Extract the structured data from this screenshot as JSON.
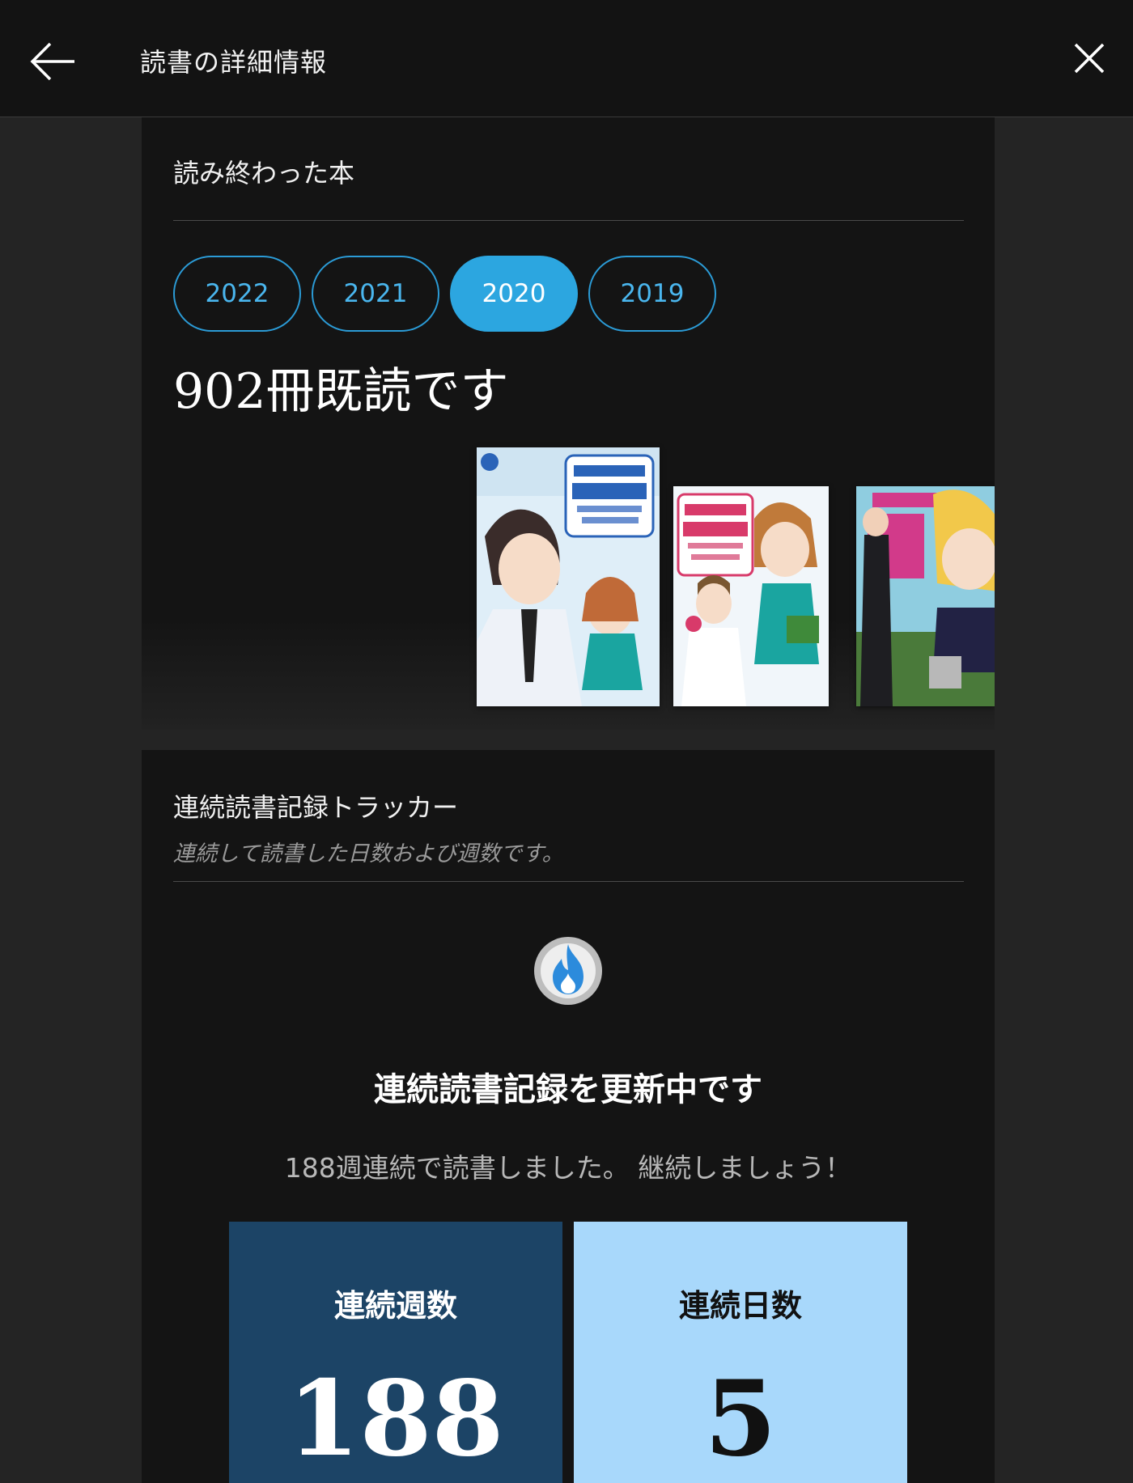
{
  "header": {
    "title": "読書の詳細情報",
    "back_icon": "arrow-left-icon",
    "close_icon": "close-icon"
  },
  "finished_books": {
    "heading": "読み終わった本",
    "year_tabs": [
      "2022",
      "2021",
      "2020",
      "2019"
    ],
    "selected_year": "2020",
    "count_text": "902冊既読です",
    "accent_color": "#2ca6e0"
  },
  "streak": {
    "heading": "連続読書記録トラッカー",
    "subheading": "連続して読書した日数および週数です。",
    "icon": "flame-icon",
    "title": "連続読書記録を更新中です",
    "message": "188週連続で読書しました。 継続しましょう！",
    "weeks_label": "連続週数",
    "weeks_value": "188",
    "days_label": "連続日数",
    "days_value": "5",
    "weeks_color": "#1c4466",
    "days_color": "#a8d8fb"
  }
}
